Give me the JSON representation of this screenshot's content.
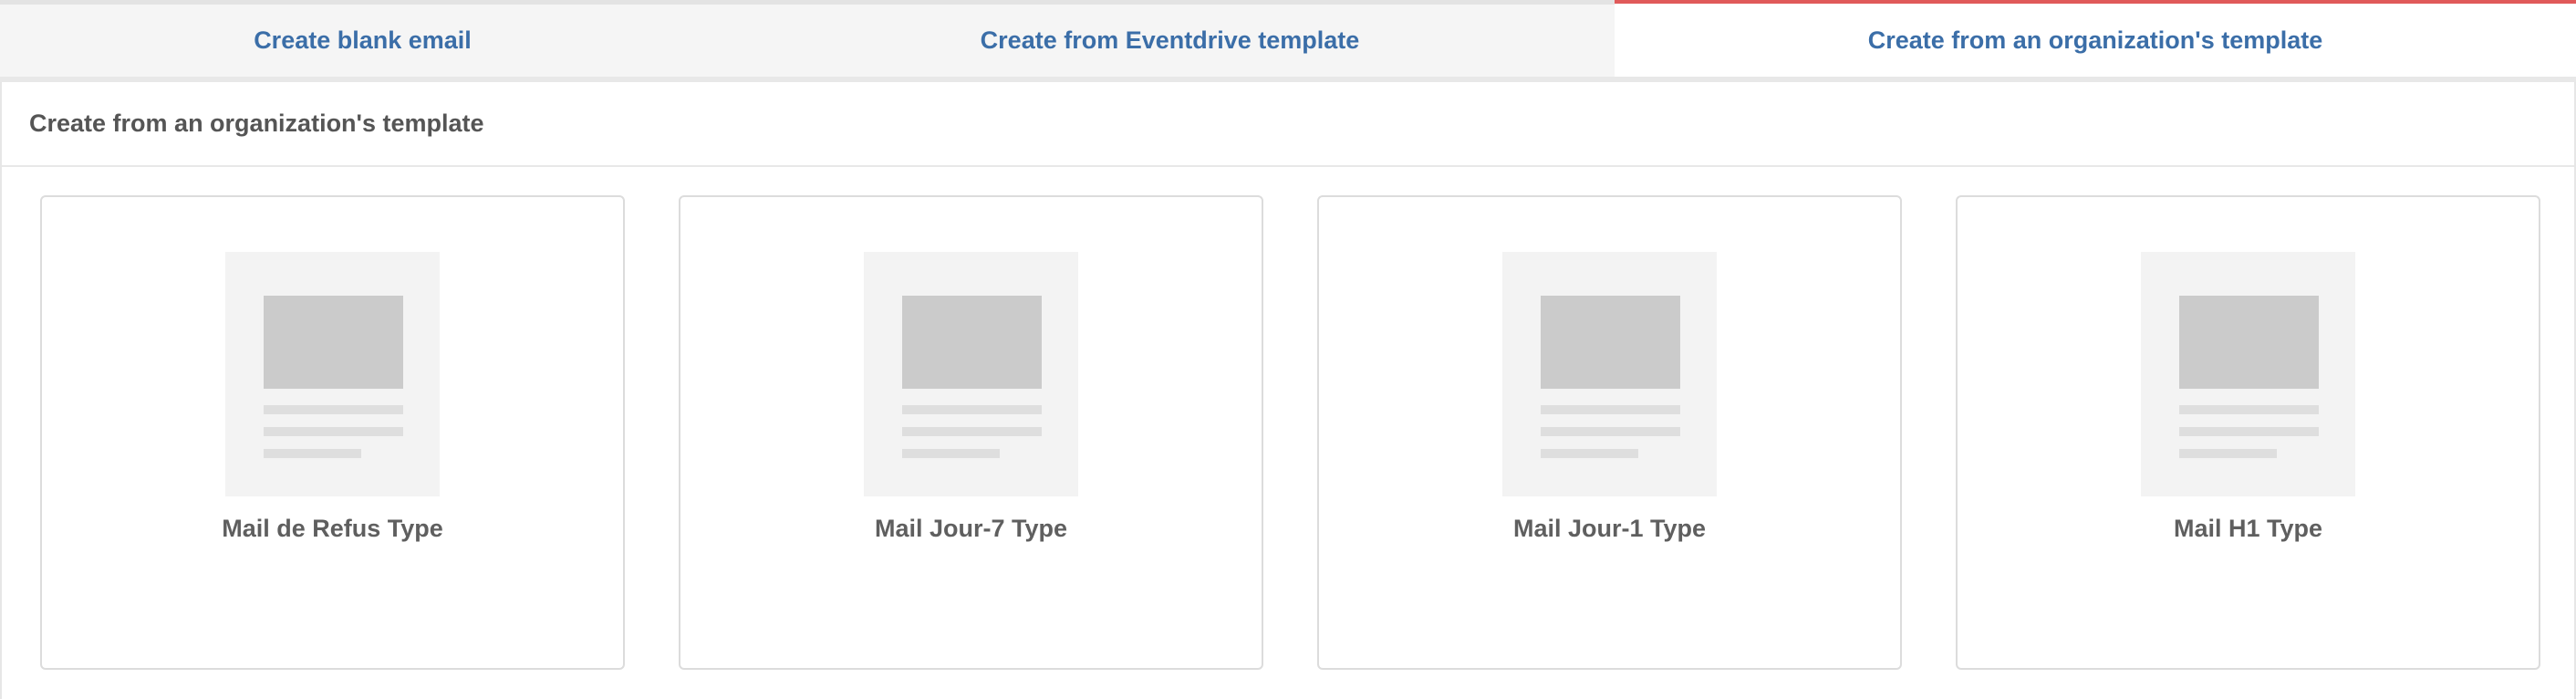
{
  "tabs": [
    {
      "label": "Create blank email",
      "active": false
    },
    {
      "label": "Create from Eventdrive template",
      "active": false
    },
    {
      "label": "Create from an organization's template",
      "active": true
    }
  ],
  "colors": {
    "tab_text": "#3b6ea8",
    "active_tab_indicator": "#e05a5a"
  },
  "panel": {
    "title": "Create from an organization's template",
    "templates": [
      {
        "name": "Mail de Refus Type",
        "icon": "email-template-thumbnail-icon"
      },
      {
        "name": "Mail Jour-7 Type",
        "icon": "email-template-thumbnail-icon"
      },
      {
        "name": "Mail Jour-1 Type",
        "icon": "email-template-thumbnail-icon"
      },
      {
        "name": "Mail H1 Type",
        "icon": "email-template-thumbnail-icon"
      }
    ]
  }
}
